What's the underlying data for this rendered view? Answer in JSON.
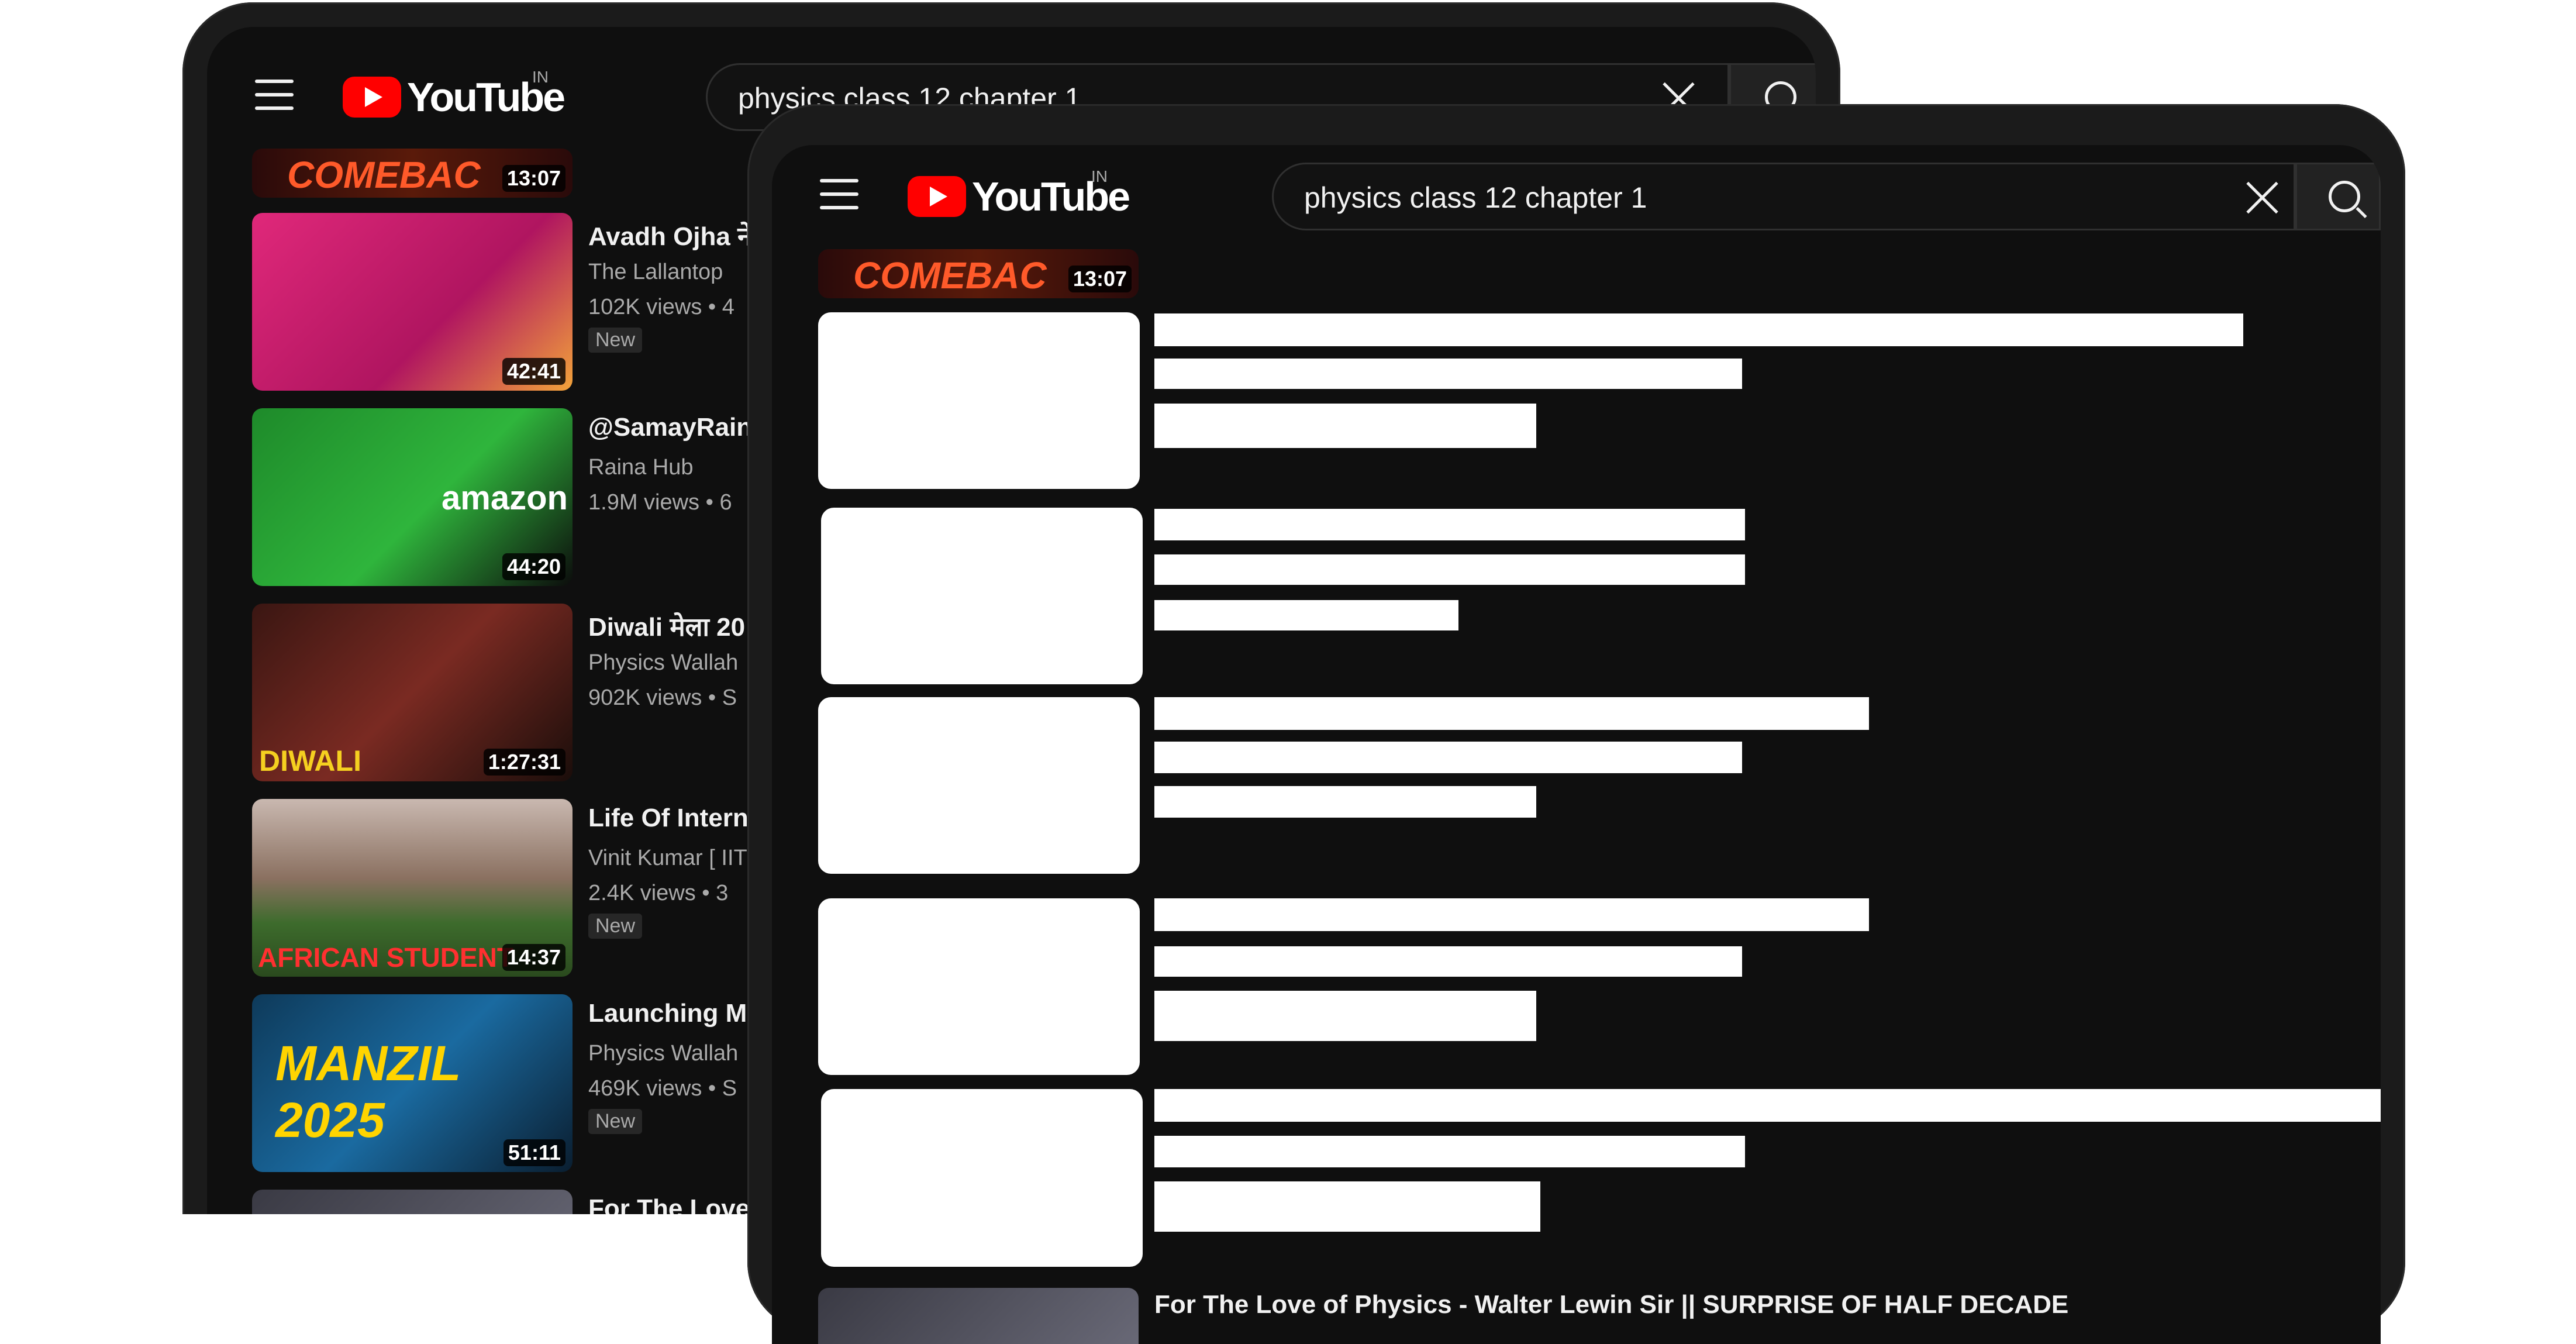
{
  "app": {
    "logo_text": "YouTube",
    "region": "IN"
  },
  "search": {
    "query": "physics class 12 chapter 1"
  },
  "colors": {
    "background": "#0f0f0f",
    "brand_red": "#ff0000",
    "text_primary": "#f1f1f1",
    "text_secondary": "#aaaaaa"
  },
  "icons": {
    "menu": "hamburger-icon",
    "clear": "close-icon",
    "search": "search-icon"
  },
  "back_device": {
    "top_partial": {
      "thumb_text": "COMEBAC",
      "duration": "13:07"
    },
    "videos": [
      {
        "title": "Avadh Ojha ने",
        "channel": "The Lallantop",
        "meta": "102K views • 4",
        "badge": "New",
        "duration": "42:41"
      },
      {
        "title": "@SamayRain",
        "channel": "Raina Hub",
        "meta": "1.9M views • 6",
        "badge": "",
        "duration": "44:20"
      },
      {
        "title": "Diwali मेला 20",
        "channel": "Physics Wallah",
        "meta": "902K views • S",
        "badge": "",
        "duration": "1:27:31"
      },
      {
        "title": "Life Of Intern",
        "channel": "Vinit Kumar [ IIT",
        "meta": "2.4K views • 3",
        "badge": "New",
        "duration": "14:37"
      },
      {
        "title": "Launching M",
        "channel": "Physics Wallah",
        "meta": "469K views • S",
        "badge": "New",
        "duration": "51:11"
      },
      {
        "title": "For The Love",
        "channel": "",
        "meta": "",
        "badge": "",
        "duration": ""
      }
    ]
  },
  "front_device": {
    "top_partial": {
      "thumb_text": "COMEBAC",
      "duration": "13:07"
    },
    "last_title": "For The Love of Physics - Walter Lewin Sir || SURPRISE OF HALF DECADE"
  }
}
